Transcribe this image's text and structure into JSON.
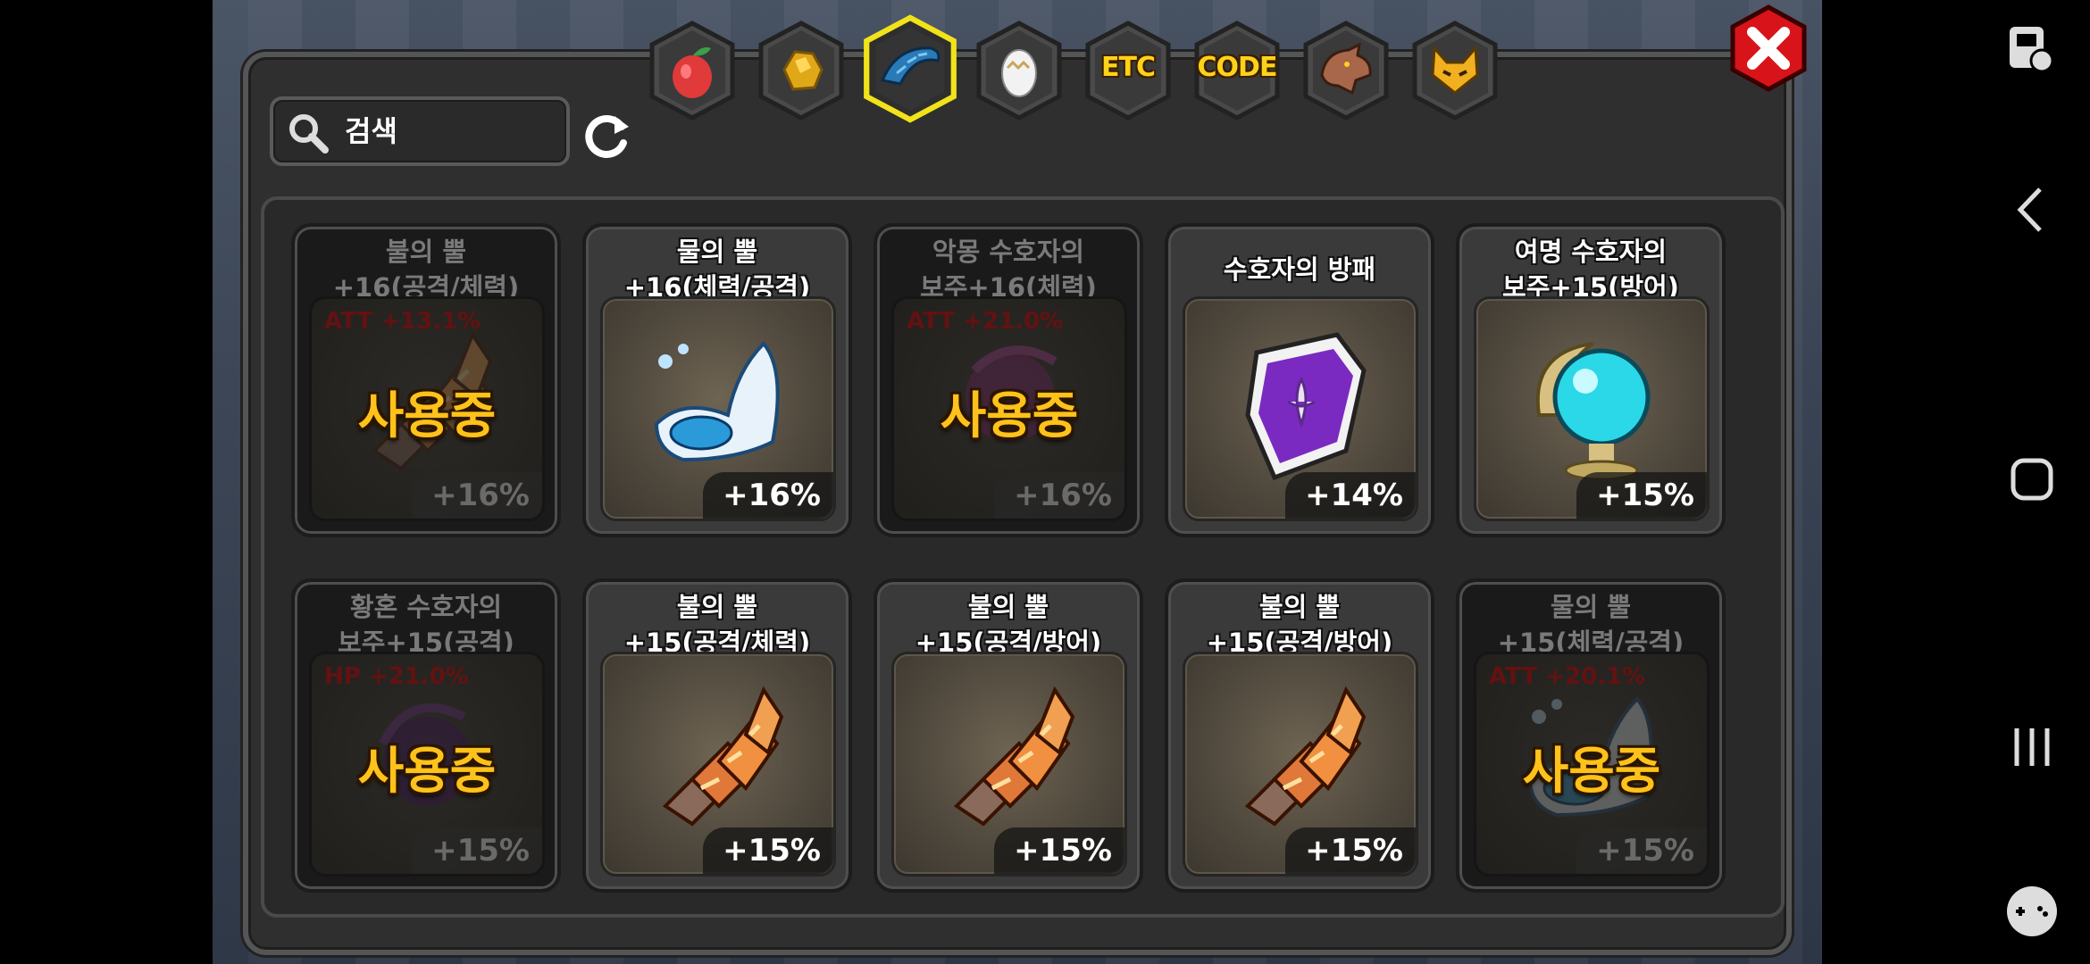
{
  "search": {
    "placeholder": "검색",
    "value": ""
  },
  "tabs": [
    {
      "name": "fruit",
      "label": ""
    },
    {
      "name": "ore",
      "label": ""
    },
    {
      "name": "horn",
      "label": ""
    },
    {
      "name": "egg",
      "label": ""
    },
    {
      "name": "etc",
      "label": "ETC"
    },
    {
      "name": "code",
      "label": "CODE"
    },
    {
      "name": "dragon",
      "label": ""
    },
    {
      "name": "pet",
      "label": ""
    }
  ],
  "selected_tab": "horn",
  "items": [
    {
      "title": "불의 뿔\n+16(공격/체력)",
      "pct": "+16%",
      "in_use": true,
      "stat_hint": "ATT +13.1%",
      "icon": "fire-horn-icon"
    },
    {
      "title": "물의 뿔\n+16(체력/공격)",
      "pct": "+16%",
      "in_use": false,
      "stat_hint": "",
      "icon": "water-horn-icon"
    },
    {
      "title": "악몽 수호자의\n보주+16(체력)",
      "pct": "+16%",
      "in_use": true,
      "stat_hint": "ATT +21.0%",
      "icon": "nightmare-orb-icon"
    },
    {
      "title": "수호자의 방패",
      "pct": "+14%",
      "in_use": false,
      "stat_hint": "",
      "icon": "guardian-shield-icon"
    },
    {
      "title": "여명 수호자의\n보주+15(방어)",
      "pct": "+15%",
      "in_use": false,
      "stat_hint": "",
      "icon": "dawn-orb-icon"
    },
    {
      "title": "황혼 수호자의\n보주+15(공격)",
      "pct": "+15%",
      "in_use": true,
      "stat_hint": "HP +21.0%",
      "icon": "dusk-orb-icon"
    },
    {
      "title": "불의 뿔\n+15(공격/체력)",
      "pct": "+15%",
      "in_use": false,
      "stat_hint": "",
      "icon": "fire-horn-icon"
    },
    {
      "title": "불의 뿔\n+15(공격/방어)",
      "pct": "+15%",
      "in_use": false,
      "stat_hint": "",
      "icon": "fire-horn-icon"
    },
    {
      "title": "불의 뿔\n+15(공격/방어)",
      "pct": "+15%",
      "in_use": false,
      "stat_hint": "",
      "icon": "fire-horn-icon"
    },
    {
      "title": "물의 뿔\n+15(체력/공격)",
      "pct": "+15%",
      "in_use": true,
      "stat_hint": "ATT +20.1%",
      "icon": "water-horn-icon"
    }
  ],
  "in_use_label": "사용중",
  "colors": {
    "tab_selected_border": "#f2e21a",
    "close_red": "#d8131a",
    "in_use_text": "#ffc21a"
  }
}
